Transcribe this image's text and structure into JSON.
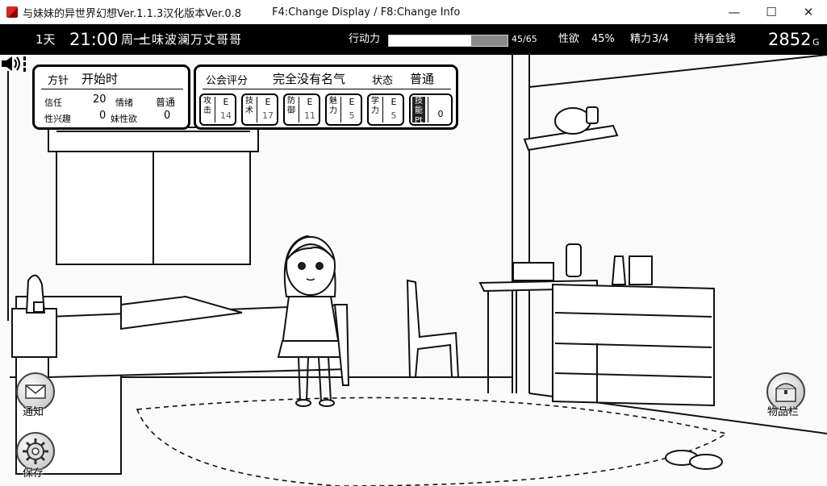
{
  "window": {
    "title": "与妹妹的异世界幻想Ver.1.1.3汉化版本Ver.0.8",
    "hint": "F4:Change Display / F8:Change Info",
    "minimize": "—",
    "maximize": "☐",
    "close": "✕"
  },
  "status": {
    "day": "1天",
    "time": "21:00",
    "weekday": "周一",
    "weather": "土味波澜万丈哥哥",
    "action_label": "行动力",
    "action_value": "45/65",
    "action_fraction": 0.692,
    "lust_label": "性欲",
    "lust_value": "45%",
    "stamina_label": "精力",
    "stamina_value": "3/4",
    "money_label": "持有金钱",
    "money_value": "2852",
    "money_unit": "G"
  },
  "panel_left": {
    "policy_label": "方针",
    "policy_value": "开始时",
    "trust_label": "信任",
    "trust_value": "20",
    "mood_label": "情绪",
    "mood_value": "普通",
    "sex_interest_label": "性兴趣",
    "sex_interest_value": "0",
    "lust_label": "妹性欲",
    "lust_value": "0"
  },
  "panel_right": {
    "guild_label": "公会评分",
    "guild_value": "完全没有名气",
    "state_label": "状态",
    "state_value": "普通",
    "skills": [
      {
        "name": "攻击",
        "grade": "E",
        "value": "14"
      },
      {
        "name": "技术",
        "grade": "E",
        "value": "17"
      },
      {
        "name": "防御",
        "grade": "E",
        "value": "11"
      },
      {
        "name": "魅力",
        "grade": "E",
        "value": "5"
      },
      {
        "name": "学力",
        "grade": "E",
        "value": "5"
      },
      {
        "name": "技能Pt",
        "grade": "",
        "value": "0"
      }
    ]
  },
  "buttons": {
    "notify": "通知",
    "save": "保存",
    "inventory": "物品栏"
  }
}
